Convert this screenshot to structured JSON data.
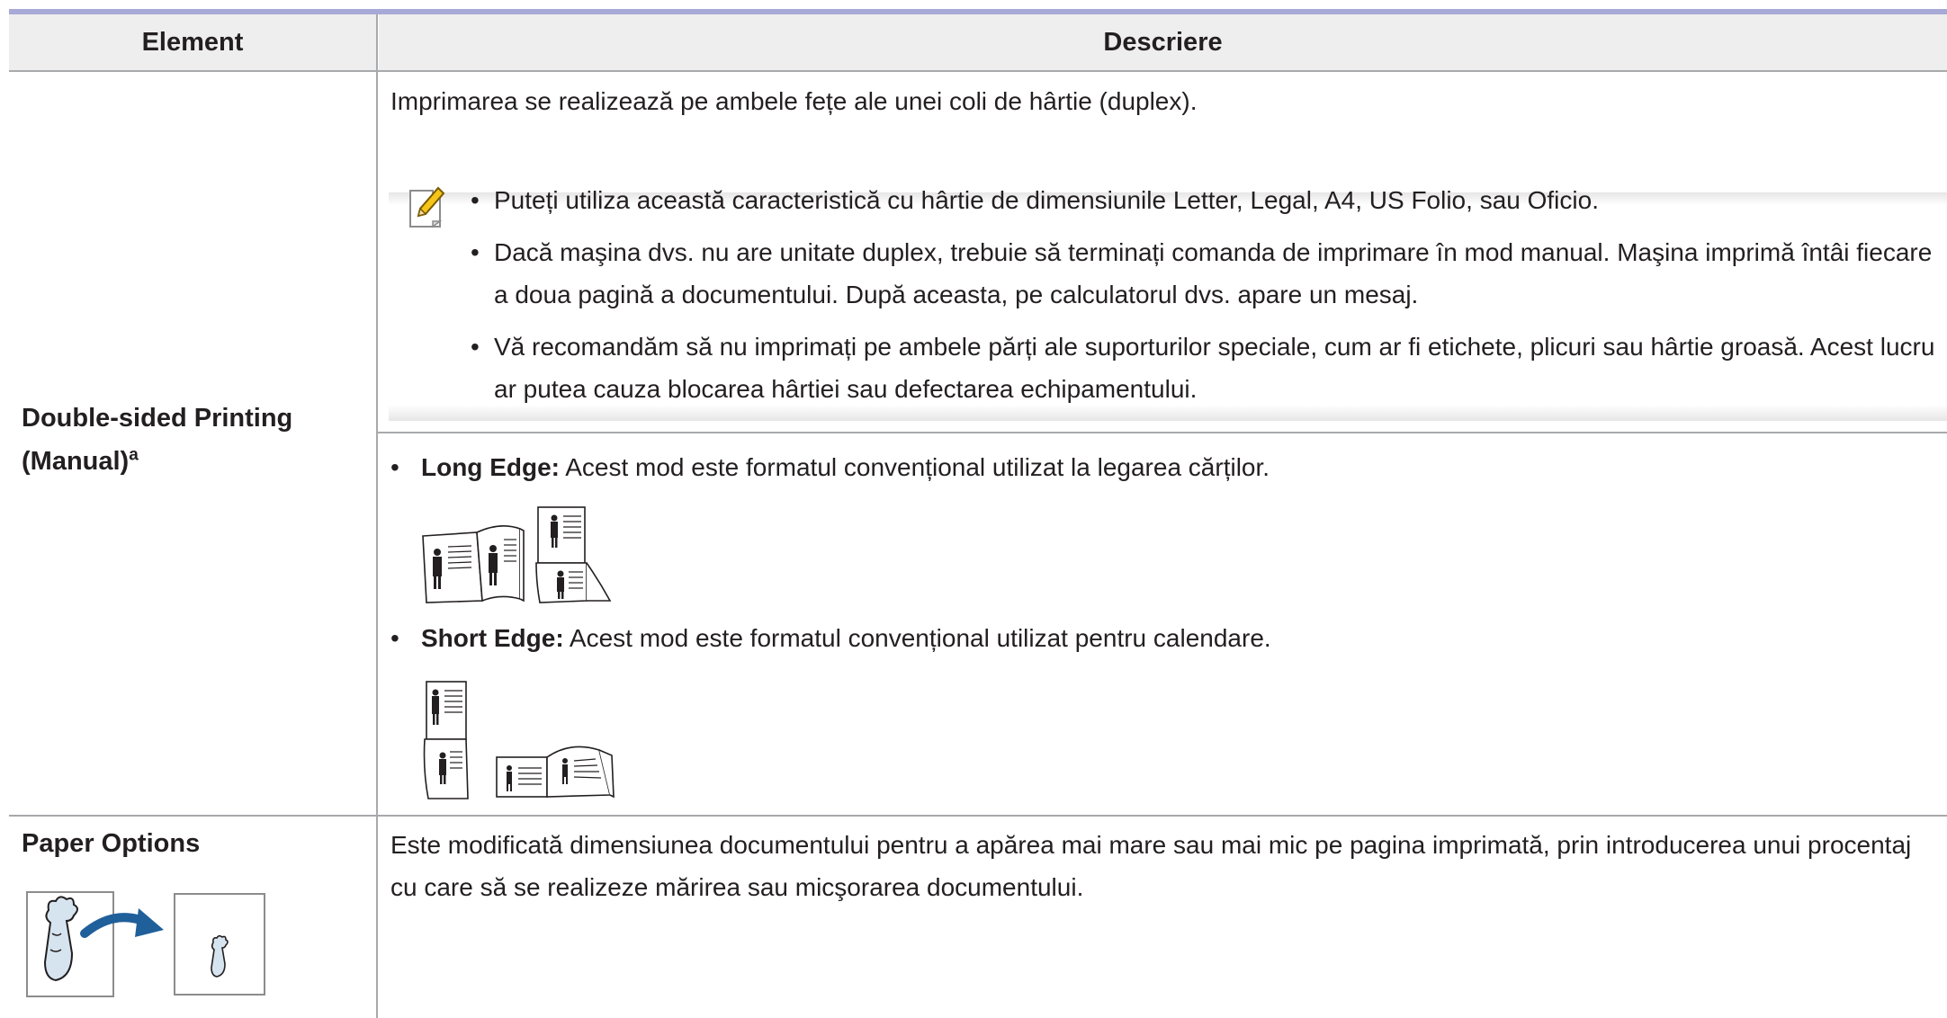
{
  "table": {
    "headers": {
      "element": "Element",
      "description": "Descriere"
    },
    "rows": [
      {
        "label": "Double-sided Printing (Manual)",
        "label_line1": "Double-sided Printing",
        "label_line2": "(Manual)",
        "footnote": "a",
        "intro": "Imprimarea se realizează pe ambele fețe ale unei coli de hârtie (duplex).",
        "note_icon": "pencil-note-icon",
        "notes": [
          "Puteți utiliza această caracteristică cu hârtie de dimensiunile Letter, Legal, A4, US Folio, sau Oficio.",
          "Dacă maşina dvs. nu are unitate duplex, trebuie să terminați comanda de imprimare în mod manual. Maşina imprimă întâi fiecare a doua pagină a documentului. După aceasta, pe calculatorul dvs. apare un mesaj.",
          "Vă recomandăm să nu imprimați pe ambele părți ale suporturilor speciale, cum ar fi etichete, plicuri sau hârtie groasă. Acest lucru ar putea cauza blocarea hârtiei sau defectarea echipamentului."
        ],
        "options": [
          {
            "name": "Long Edge:",
            "text": "Acest mod este formatul convențional utilizat la legarea cărților.",
            "icon": "long-edge-binding-icon"
          },
          {
            "name": "Short Edge:",
            "text": "Acest mod este formatul convențional utilizat pentru calendare.",
            "icon": "short-edge-binding-icon"
          }
        ]
      },
      {
        "label": "Paper Options",
        "icon": "reduce-document-size-icon",
        "description": "Este modificată dimensiunea documentului pentru a apărea mai mare sau mai mic pe pagina imprimată, prin introducerea unui procentaj cu care să se realizeze mărirea sau micşorarea documentului."
      }
    ]
  },
  "colors": {
    "header_bg": "#eeeeee",
    "rule": "#a7a9d6",
    "grid": "#a7a9ac",
    "arrow": "#1f5f9a",
    "note_icon": "#f5c518"
  }
}
